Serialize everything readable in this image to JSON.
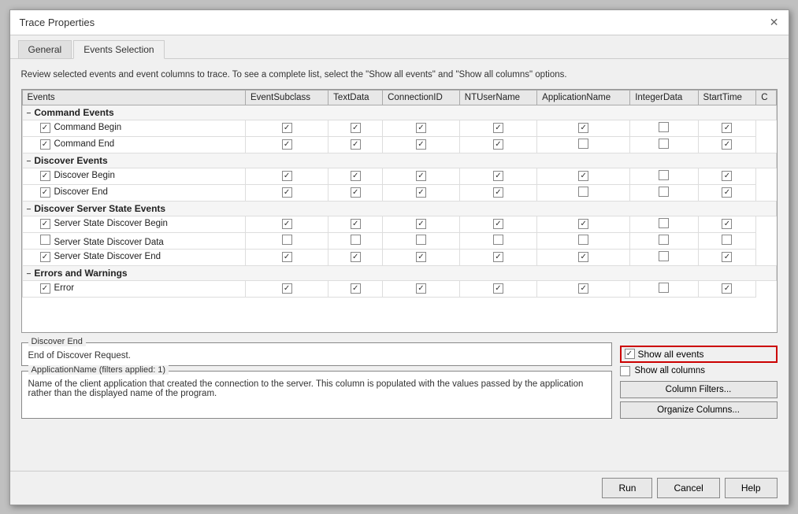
{
  "dialog": {
    "title": "Trace Properties",
    "close_label": "✕"
  },
  "tabs": [
    {
      "id": "general",
      "label": "General",
      "active": false
    },
    {
      "id": "events-selection",
      "label": "Events Selection",
      "active": true
    }
  ],
  "description": "Review selected events and event columns to trace. To see a complete list, select the \"Show all events\" and \"Show all columns\" options.",
  "table": {
    "columns": [
      "Events",
      "EventSubclass",
      "TextData",
      "ConnectionID",
      "NTUserName",
      "ApplicationName",
      "IntegerData",
      "StartTime",
      "C"
    ],
    "groups": [
      {
        "name": "Command Events",
        "collapsed": false,
        "rows": [
          {
            "name": "Command Begin",
            "checked": true,
            "cols": [
              true,
              true,
              true,
              true,
              true,
              false,
              true
            ]
          },
          {
            "name": "Command End",
            "checked": true,
            "cols": [
              true,
              true,
              true,
              true,
              false,
              false,
              true
            ]
          }
        ]
      },
      {
        "name": "Discover Events",
        "collapsed": false,
        "rows": [
          {
            "name": "Discover Begin",
            "checked": true,
            "cols": [
              true,
              true,
              true,
              true,
              true,
              false,
              true
            ]
          },
          {
            "name": "Discover End",
            "checked": true,
            "cols": [
              true,
              true,
              true,
              true,
              false,
              false,
              true
            ]
          }
        ]
      },
      {
        "name": "Discover Server State Events",
        "collapsed": false,
        "rows": [
          {
            "name": "Server State Discover Begin",
            "checked": true,
            "cols": [
              true,
              true,
              true,
              true,
              true,
              false,
              true
            ]
          },
          {
            "name": "Server State Discover Data",
            "checked": false,
            "cols": [
              false,
              false,
              false,
              false,
              false,
              false,
              false
            ]
          },
          {
            "name": "Server State Discover End",
            "checked": true,
            "cols": [
              true,
              true,
              true,
              true,
              true,
              false,
              true
            ]
          }
        ]
      },
      {
        "name": "Errors and Warnings",
        "collapsed": false,
        "rows": [
          {
            "name": "Error",
            "checked": true,
            "cols": [
              true,
              true,
              true,
              true,
              true,
              false,
              true
            ]
          }
        ]
      }
    ]
  },
  "discover_end_box": {
    "title": "Discover End",
    "content": "End of Discover Request."
  },
  "show_options": {
    "show_all_events_label": "Show all events",
    "show_all_events_checked": true,
    "show_all_columns_label": "Show all columns",
    "show_all_columns_checked": false
  },
  "action_buttons": {
    "column_filters": "Column Filters...",
    "organize_columns": "Organize Columns..."
  },
  "app_name_box": {
    "title": "ApplicationName (filters applied: 1)",
    "content": "Name of the client application that created the connection to the server. This column is populated with the values passed by the application rather than the displayed name of the program."
  },
  "footer_buttons": {
    "run": "Run",
    "cancel": "Cancel",
    "help": "Help"
  }
}
